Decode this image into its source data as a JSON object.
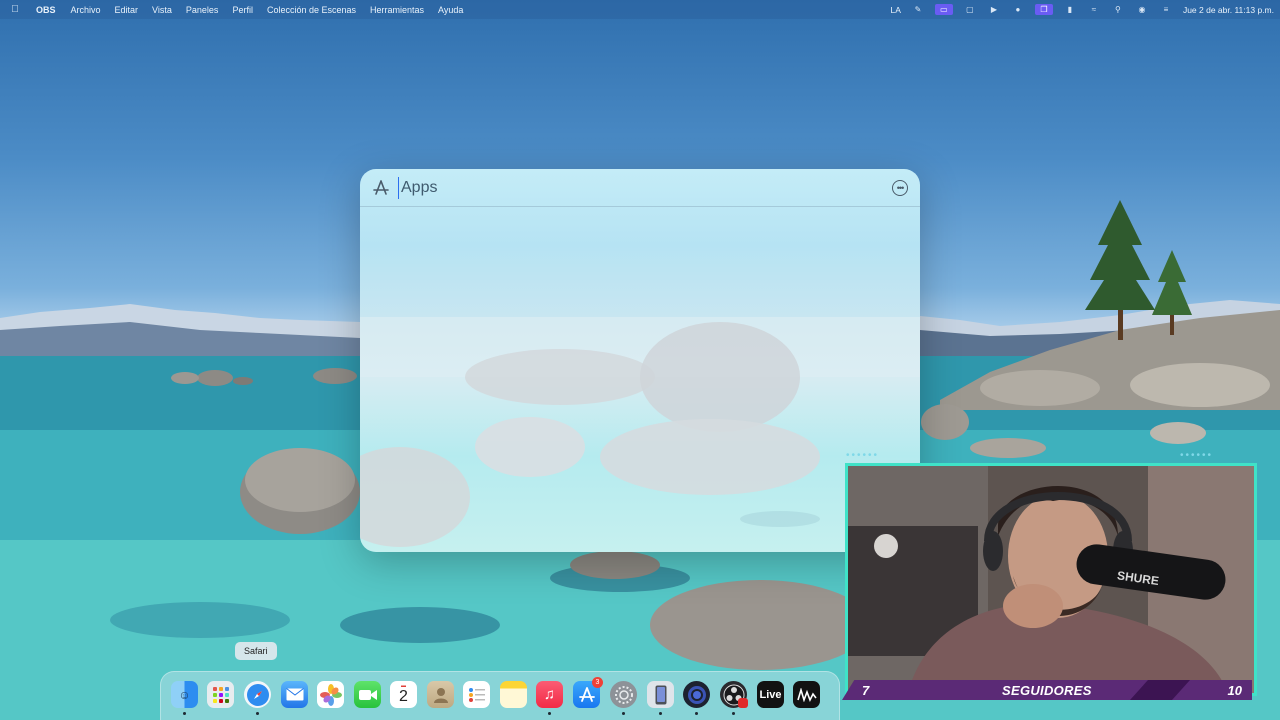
{
  "menubar": {
    "apple_icon": "apple-icon",
    "app_name": "OBS",
    "menus": [
      "Archivo",
      "Editar",
      "Vista",
      "Paneles",
      "Perfil",
      "Colección de Escenas",
      "Herramientas",
      "Ayuda"
    ],
    "status": {
      "keyboard_layout": "LA",
      "date_time": "Jue 2 de abr.  11:13 p.m."
    }
  },
  "spotlight": {
    "scope_icon": "app-store-icon",
    "query": "Apps",
    "more_icon": "ellipsis-circle-icon"
  },
  "tooltip": {
    "label": "Safari"
  },
  "dock": {
    "items": [
      {
        "name": "Finder",
        "icon": "finder-icon",
        "running": true
      },
      {
        "name": "Launchpad",
        "icon": "launchpad-icon",
        "running": false
      },
      {
        "name": "Safari",
        "icon": "safari-icon",
        "running": true
      },
      {
        "name": "Mail",
        "icon": "mail-icon",
        "running": false
      },
      {
        "name": "Fotos",
        "icon": "photos-icon",
        "running": false
      },
      {
        "name": "FaceTime",
        "icon": "facetime-icon",
        "running": false
      },
      {
        "name": "Calendario",
        "icon": "calendar-icon",
        "day": "2",
        "running": false
      },
      {
        "name": "Contactos",
        "icon": "contacts-icon",
        "running": false
      },
      {
        "name": "Recordatorios",
        "icon": "reminders-icon",
        "running": false
      },
      {
        "name": "Notas",
        "icon": "notes-icon",
        "running": false
      },
      {
        "name": "Música",
        "icon": "music-icon",
        "running": true
      },
      {
        "name": "App Store",
        "icon": "app-store-icon",
        "badge": "3",
        "running": false
      },
      {
        "name": "Configuración del Sistema",
        "icon": "settings-icon",
        "running": true
      },
      {
        "name": "Simulator",
        "icon": "phone-icon",
        "running": true
      },
      {
        "name": "Aplicación",
        "icon": "circle-app-icon",
        "running": true
      },
      {
        "name": "OBS",
        "icon": "obs-icon",
        "running": true
      },
      {
        "name": "Live",
        "icon": "live-icon",
        "label": "Live",
        "running": false
      },
      {
        "name": "Audio",
        "icon": "waveform-icon",
        "running": false
      }
    ]
  },
  "overlay": {
    "followers_current": "7",
    "followers_label": "SEGUIDORES",
    "followers_goal": "10"
  }
}
